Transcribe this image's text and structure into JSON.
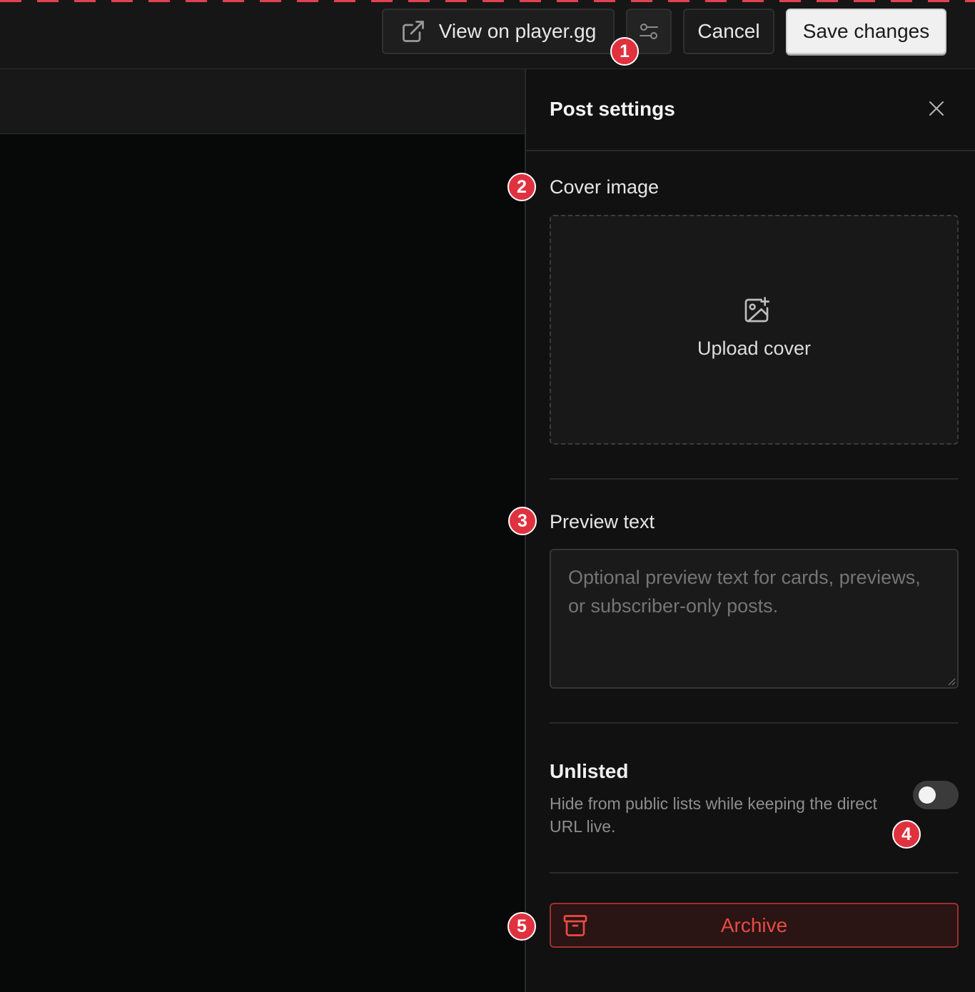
{
  "topbar": {
    "view_label": "View on player.gg",
    "cancel_label": "Cancel",
    "save_label": "Save changes"
  },
  "panel": {
    "title": "Post settings",
    "cover": {
      "label": "Cover image",
      "upload_label": "Upload cover"
    },
    "preview": {
      "label": "Preview text",
      "placeholder": "Optional preview text for cards, previews, or subscriber-only posts."
    },
    "unlisted": {
      "title": "Unlisted",
      "description": "Hide from public lists while keeping the direct URL live.",
      "enabled": false
    },
    "archive_label": "Archive"
  },
  "markers": [
    "1",
    "2",
    "3",
    "4",
    "5"
  ],
  "colors": {
    "accent_red": "#e0313f",
    "danger_text": "#e84b43",
    "background": "#111111"
  },
  "icons": [
    "external-link-icon",
    "sliders-icon",
    "close-icon",
    "image-plus-icon",
    "archive-icon"
  ]
}
